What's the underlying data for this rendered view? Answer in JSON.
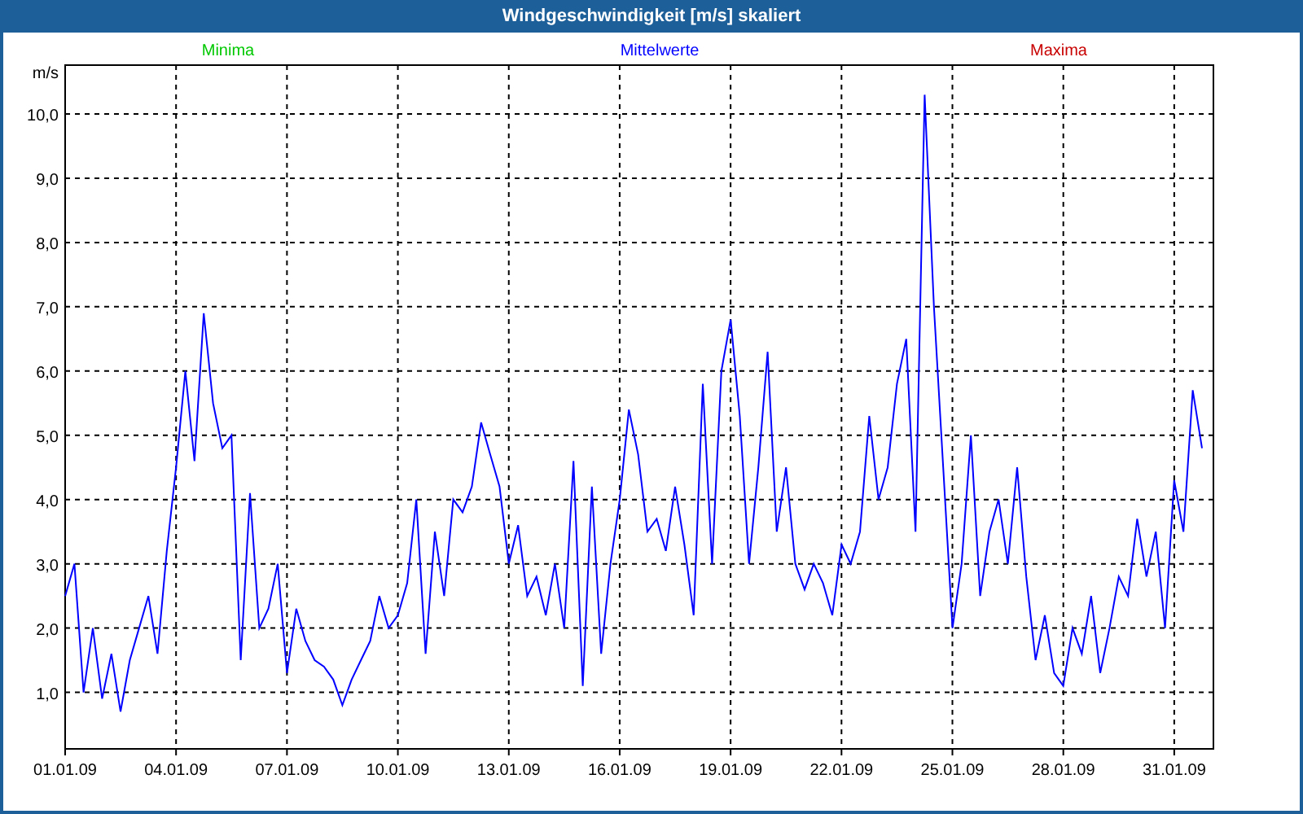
{
  "window": {
    "title": "Windgeschwindigkeit [m/s] skaliert"
  },
  "legend": [
    {
      "label": "Minima",
      "color": "#00c800"
    },
    {
      "label": "Maxima",
      "color": "#c80000"
    }
  ],
  "chart_data": {
    "type": "line",
    "grid": true,
    "ylabel": "m/s",
    "ylim": [
      0.12,
      10.76
    ],
    "categories": [
      "01.01.09",
      null,
      null,
      null,
      null,
      null,
      null,
      null,
      null,
      null,
      null,
      null,
      "04.01.09",
      null,
      null,
      null,
      null,
      null,
      null,
      null,
      null,
      null,
      null,
      null,
      "07.01.09",
      null,
      null,
      null,
      null,
      null,
      null,
      null,
      null,
      null,
      null,
      null,
      "10.01.09",
      null,
      null,
      null,
      null,
      null,
      null,
      null,
      null,
      null,
      null,
      null,
      "13.01.09",
      null,
      null,
      null,
      null,
      null,
      null,
      null,
      null,
      null,
      null,
      null,
      "16.01.09",
      null,
      null,
      null,
      null,
      null,
      null,
      null,
      null,
      null,
      null,
      null,
      "19.01.09",
      null,
      null,
      null,
      null,
      null,
      null,
      null,
      null,
      null,
      null,
      null,
      "22.01.09",
      null,
      null,
      null,
      null,
      null,
      null,
      null,
      null,
      null,
      null,
      null,
      "25.01.09",
      null,
      null,
      null,
      null,
      null,
      null,
      null,
      null,
      null,
      null,
      null,
      "28.01.09",
      null,
      null,
      null,
      null,
      null,
      null,
      null,
      null,
      null,
      null,
      null,
      "31.01.09",
      null,
      null,
      null
    ],
    "yticks": [
      {
        "value": 1,
        "label": "1,0"
      },
      {
        "value": 2,
        "label": "2,0"
      },
      {
        "value": 3,
        "label": "3,0"
      },
      {
        "value": 4,
        "label": "4,0"
      },
      {
        "value": 5,
        "label": "5,0"
      },
      {
        "value": 6,
        "label": "6,0"
      },
      {
        "value": 7,
        "label": "7,0"
      },
      {
        "value": 8,
        "label": "8,0"
      },
      {
        "value": 9,
        "label": "9,0"
      },
      {
        "value": 10,
        "label": "10,0"
      }
    ],
    "series": [
      {
        "name": "Mittelwerte",
        "color": "#0000ff",
        "values": [
          2.5,
          3.0,
          1.0,
          2.0,
          0.9,
          1.6,
          0.7,
          1.5,
          2.0,
          2.5,
          1.6,
          3.2,
          4.5,
          6.0,
          4.6,
          6.9,
          5.5,
          4.8,
          5.0,
          1.5,
          4.1,
          2.0,
          2.3,
          3.0,
          1.3,
          2.3,
          1.8,
          1.5,
          1.4,
          1.2,
          0.8,
          1.2,
          1.5,
          1.8,
          2.5,
          2.0,
          2.2,
          2.7,
          4.0,
          1.6,
          3.5,
          2.5,
          4.0,
          3.8,
          4.2,
          5.2,
          4.7,
          4.2,
          3.0,
          3.6,
          2.5,
          2.8,
          2.2,
          3.0,
          2.0,
          4.6,
          1.1,
          4.2,
          1.6,
          3.0,
          4.0,
          5.4,
          4.7,
          3.5,
          3.7,
          3.2,
          4.2,
          3.3,
          2.2,
          5.8,
          3.0,
          6.0,
          6.8,
          5.3,
          3.0,
          4.5,
          6.3,
          3.5,
          4.5,
          3.0,
          2.6,
          3.0,
          2.7,
          2.2,
          3.3,
          3.0,
          3.5,
          5.3,
          4.0,
          4.5,
          5.8,
          6.5,
          3.5,
          10.3,
          7.0,
          4.5,
          2.0,
          3.0,
          5.0,
          2.5,
          3.5,
          4.0,
          3.0,
          4.5,
          2.8,
          1.5,
          2.2,
          1.3,
          1.1,
          2.0,
          1.6,
          2.5,
          1.3,
          2.0,
          2.8,
          2.5,
          3.7,
          2.8,
          3.5,
          2.0,
          4.3,
          3.5,
          5.7,
          4.8
        ]
      }
    ]
  }
}
